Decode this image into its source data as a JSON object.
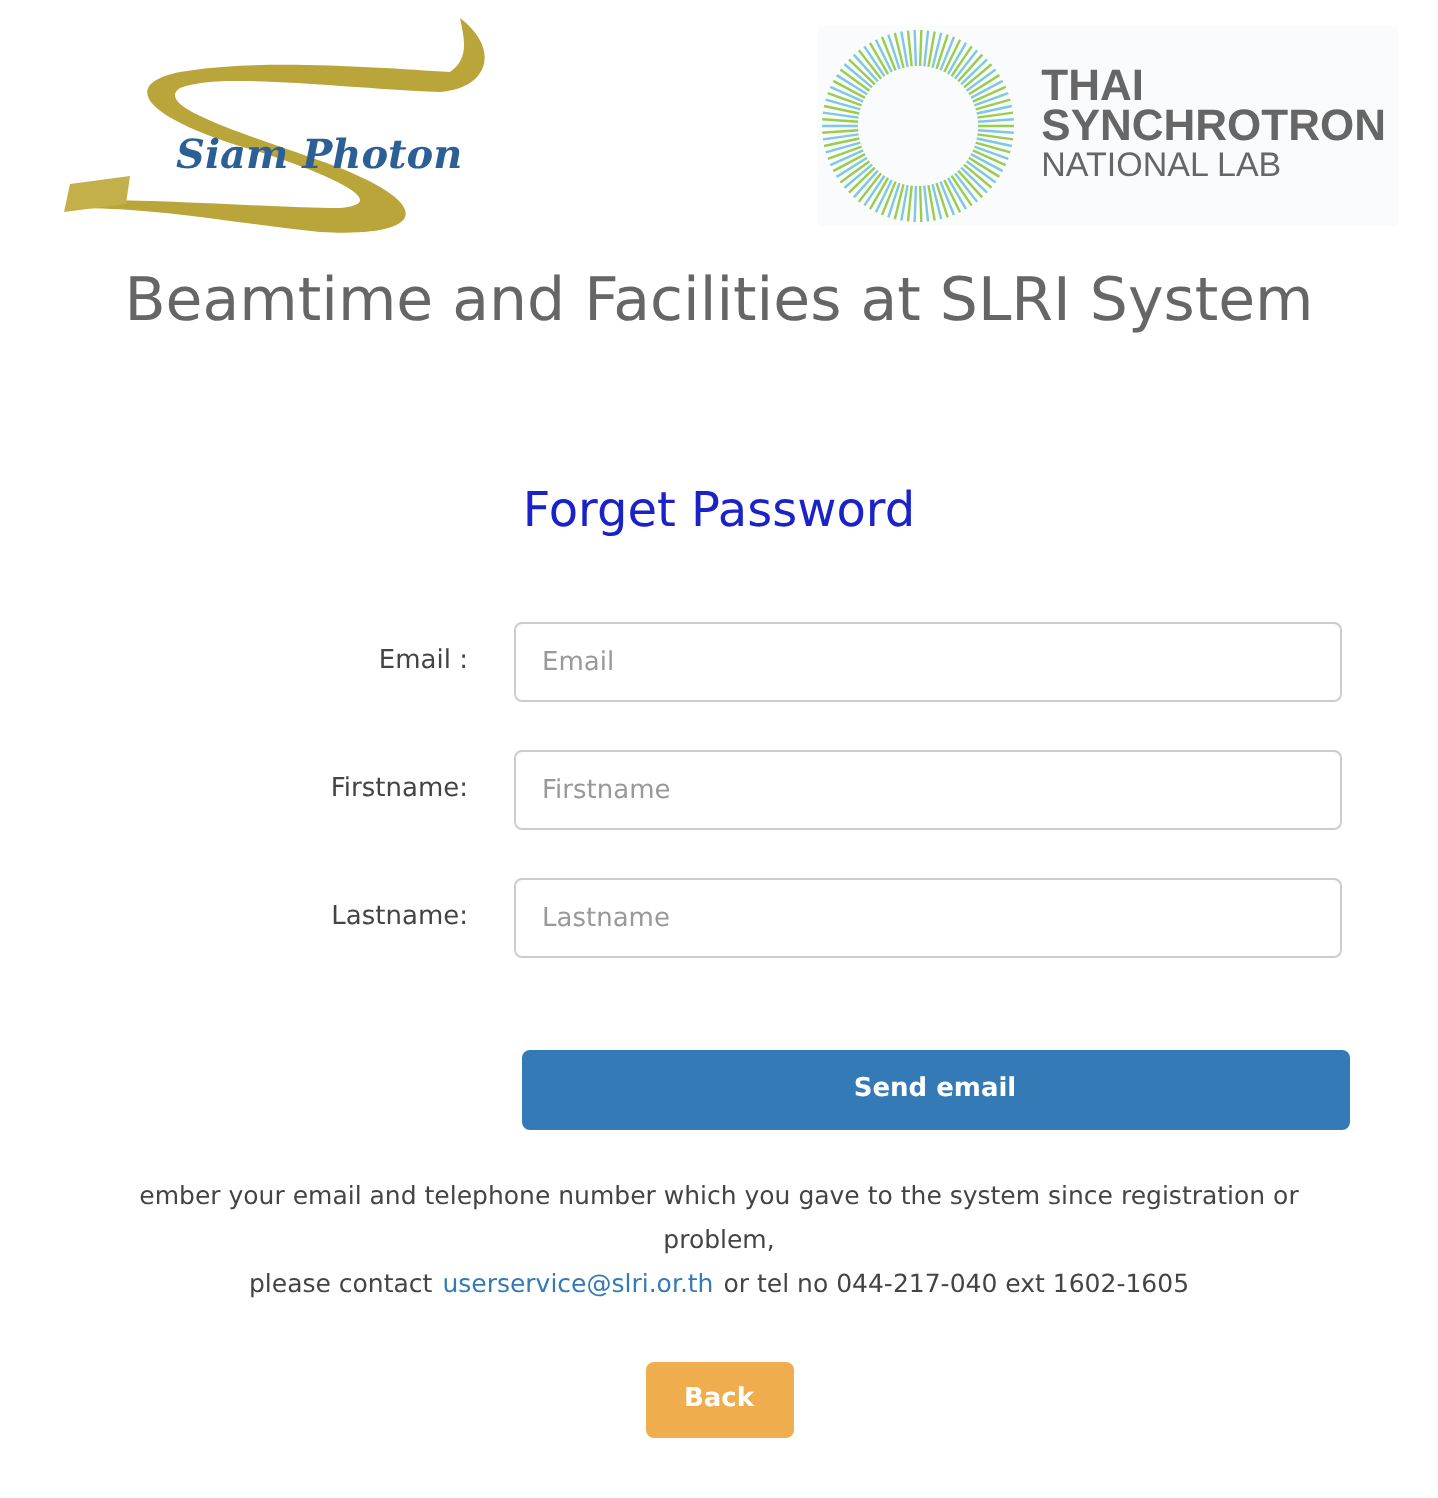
{
  "logos": {
    "left": {
      "text": "Siam Photon"
    },
    "right": {
      "lines": [
        "THAI",
        "SYNCHROTRON",
        "NATIONAL LAB"
      ]
    }
  },
  "title": "Beamtime and Facilities at SLRI System",
  "heading": "Forget Password",
  "fields": [
    {
      "label": "Email :",
      "placeholder": "Email"
    },
    {
      "label": "Firstname:",
      "placeholder": "Firstname"
    },
    {
      "label": "Lastname:",
      "placeholder": "Lastname"
    }
  ],
  "submit": "Send email",
  "notice": {
    "line1": "ember your email and telephone number which you gave to the system since registration or",
    "line2": "problem,",
    "line3_before": "please contact",
    "link": "userservice@slri.or.th",
    "line3_after": "or tel no 044-217-040 ext 1602-1605"
  },
  "back": "Back"
}
